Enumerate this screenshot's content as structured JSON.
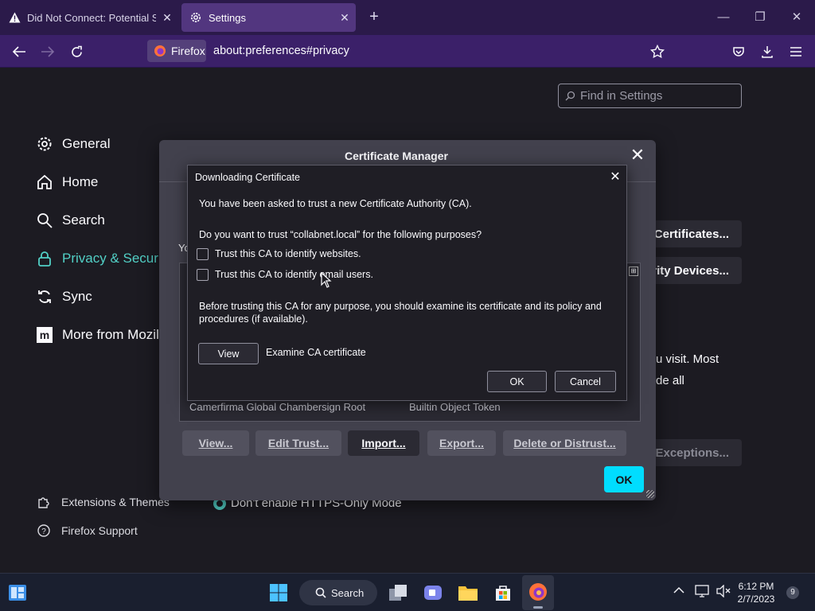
{
  "tabs": [
    {
      "label": "Did Not Connect: Potential Security Issue",
      "icon": "warning-icon"
    },
    {
      "label": "Settings",
      "icon": "gear-icon"
    }
  ],
  "navbar": {
    "identity_label": "Firefox",
    "url": "about:preferences#privacy"
  },
  "settings": {
    "search_placeholder": "Find in Settings",
    "categories": [
      {
        "label": "General",
        "icon": "gear-icon"
      },
      {
        "label": "Home",
        "icon": "home-icon"
      },
      {
        "label": "Search",
        "icon": "search-icon"
      },
      {
        "label": "Privacy & Security",
        "icon": "lock-icon",
        "selected": true
      },
      {
        "label": "Sync",
        "icon": "sync-icon"
      },
      {
        "label": "More from Mozilla",
        "icon": "mozilla-icon"
      }
    ],
    "footer": [
      {
        "label": "Extensions & Themes",
        "icon": "puzzle-icon"
      },
      {
        "label": "Firefox Support",
        "icon": "help-icon"
      }
    ],
    "background": {
      "view_certificates_label": "View Certificates...",
      "security_devices_label": "Security Devices...",
      "https_text_1": "u visit. Most",
      "https_text_2": "de all",
      "manage_exceptions_label": "Manage Exceptions...",
      "https_only_off_label": "Don't enable HTTPS-Only Mode",
      "partial_you": "Yo"
    }
  },
  "cert_manager": {
    "title": "Certificate Manager",
    "visible_row": {
      "name": "Camerfirma Global Chambersign Root",
      "device": "Builtin Object Token"
    },
    "buttons": {
      "view": "View...",
      "edit_trust": "Edit Trust...",
      "import": "Import...",
      "export": "Export...",
      "delete": "Delete or Distrust..."
    },
    "ok_label": "OK"
  },
  "download_dialog": {
    "title": "Downloading Certificate",
    "intro": "You have been asked to trust a new Certificate Authority (CA).",
    "question": "Do you want to trust “collabnet.local” for the following purposes?",
    "options": [
      {
        "label": "Trust this CA to identify websites.",
        "checked": false
      },
      {
        "label": "Trust this CA to identify email users.",
        "checked": false
      }
    ],
    "warning": "Before trusting this CA for any purpose, you should examine its certificate and its policy and procedures (if available).",
    "view_button": "View",
    "examine_label": "Examine CA certificate",
    "ok_button": "OK",
    "cancel_button": "Cancel"
  },
  "taskbar": {
    "search_label": "Search",
    "time": "6:12 PM",
    "date": "2/7/2023",
    "notification_count": "9"
  },
  "colors": {
    "accent_cyan": "#00ddff",
    "selected_category": "#52d0c6",
    "tab_strip": "#2b1a4a",
    "nav_bar": "#3b2069"
  }
}
